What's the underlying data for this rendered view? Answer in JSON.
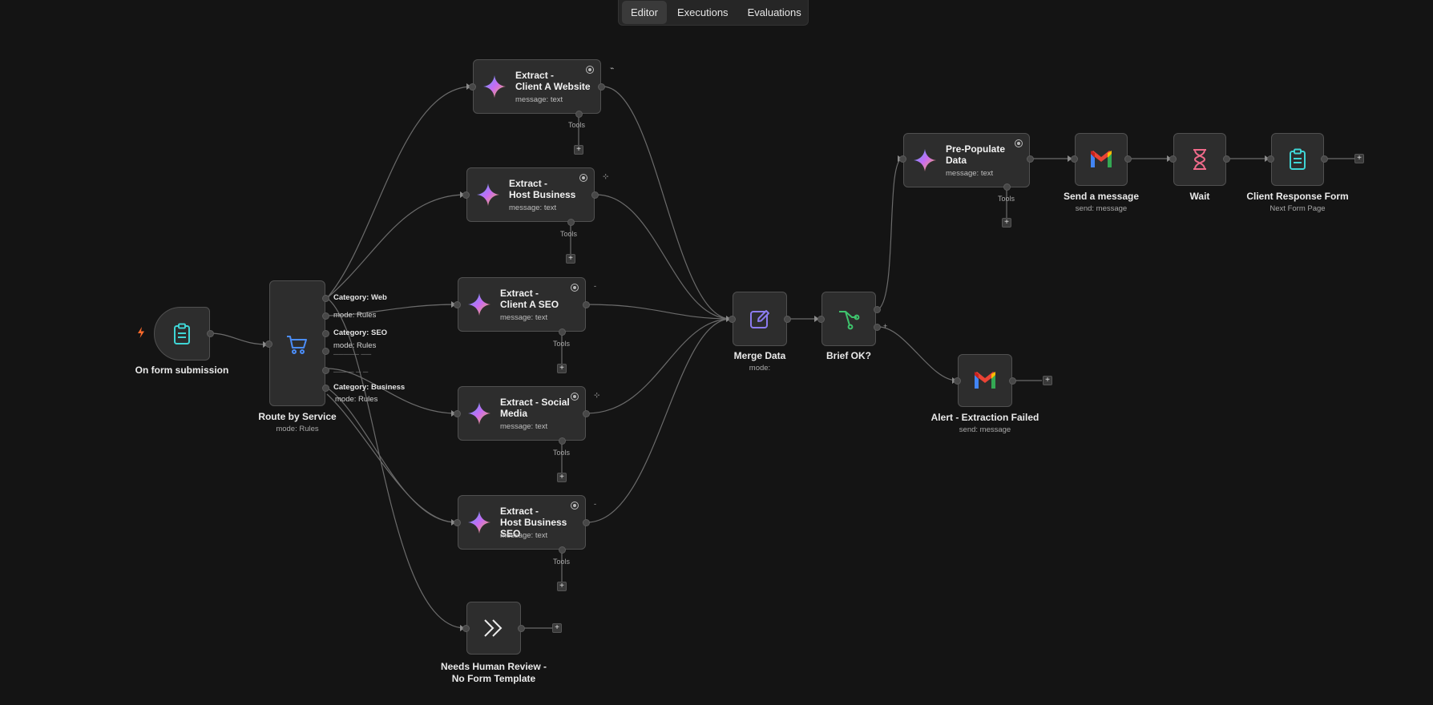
{
  "tabs": {
    "editor": "Editor",
    "executions": "Executions",
    "evaluations": "Evaluations"
  },
  "colors": {
    "background": "#141414",
    "node": "#2d2d2d",
    "edge": "#6b6b6b",
    "trigger_accent": "#3fd5d5",
    "router_accent": "#4b8df8",
    "merge_accent": "#8c7cf0",
    "if_accent": "#3ec46d",
    "wait_accent": "#f06a8a",
    "bolt": "#ff6a2b"
  },
  "nodes": {
    "trigger": {
      "label": "On form submission",
      "icon": "clipboard-icon"
    },
    "router": {
      "label": "Route by Service",
      "sub": "mode: Rules",
      "icon": "cart-router-icon",
      "outputs": {
        "o1": {
          "category": "Category: Web",
          "mode": "mode: Rules"
        },
        "o2": {
          "category": "Category: SEO",
          "mode": "mode: Rules"
        },
        "o3": {
          "category": "Category: Business",
          "mode": "mode: Rules"
        }
      }
    },
    "ext1": {
      "title_a": "Extract -",
      "title_b": "Client A Website",
      "sub": "message: text",
      "tools": "Tools"
    },
    "ext2": {
      "title_a": "Extract -",
      "title_b": "Host Business",
      "sub": "message: text",
      "tools": "Tools"
    },
    "ext3": {
      "title_a": "Extract -",
      "title_b": "Client A SEO",
      "sub": "message: text",
      "tools": "Tools"
    },
    "ext4": {
      "title_a": "Extract - Social",
      "title_b": "Media",
      "sub": "message: text",
      "tools": "Tools"
    },
    "ext5": {
      "title_a": "Extract -",
      "title_b": "Host Business SEO",
      "sub": "message: text",
      "tools": "Tools"
    },
    "review": {
      "label_a": "Needs Human Review -",
      "label_b": "No Form Template",
      "icon": "double-chevron-right-icon"
    },
    "merge": {
      "label": "Merge Data",
      "sub": "mode:",
      "icon": "edit-icon"
    },
    "brief": {
      "label": "Brief OK?",
      "icon": "if-branch-icon"
    },
    "prepop": {
      "title_a": "Pre-Populate",
      "title_b": "Data",
      "sub": "message: text",
      "tools": "Tools"
    },
    "send": {
      "label": "Send a message",
      "sub": "send: message",
      "icon": "gmail-icon"
    },
    "wait": {
      "label": "Wait",
      "icon": "hourglass-icon"
    },
    "response": {
      "label": "Client Response Form",
      "sub": "Next Form Page",
      "icon": "clipboard-icon"
    },
    "alert": {
      "label": "Alert - Extraction Failed",
      "sub": "send: message",
      "icon": "gmail-icon"
    }
  }
}
